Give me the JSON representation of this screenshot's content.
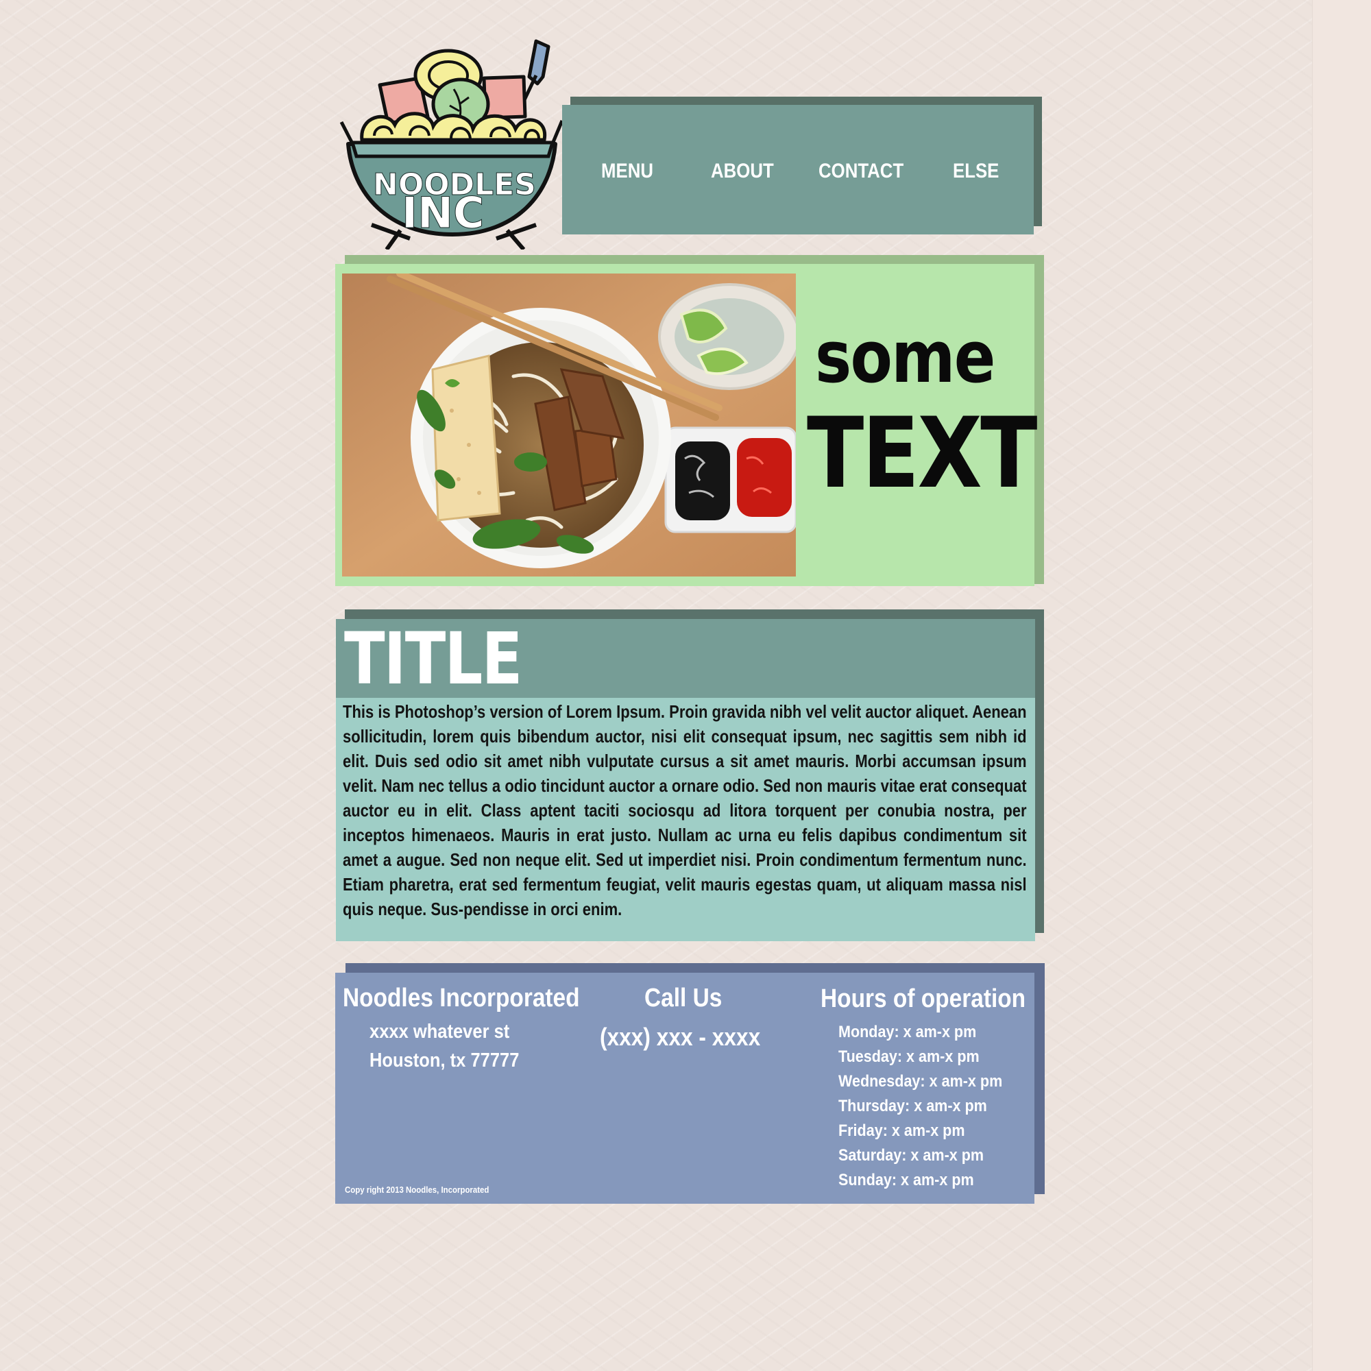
{
  "logo": {
    "line1": "NOODLES",
    "line2": "INC"
  },
  "nav": {
    "items": [
      "MENU",
      "ABOUT",
      "CONTACT",
      "ELSE"
    ]
  },
  "hero": {
    "small_text": "some",
    "big_text": "TEXT"
  },
  "content": {
    "title": "TITLE",
    "body": "This is Photoshop’s version  of Lorem Ipsum. Proin gravida nibh vel velit auctor aliquet. Aenean sollicitudin, lorem quis bibendum auctor, nisi elit consequat ipsum, nec sagittis sem nibh id elit. Duis sed odio sit amet nibh vulputate cursus a sit amet mauris. Morbi accumsan ipsum velit. Nam nec tellus a odio tincidunt auctor a ornare odio. Sed non  mauris vitae erat consequat auctor eu in elit. Class aptent taciti sociosqu ad litora torquent per conubia nostra, per inceptos himenaeos. Mauris in erat justo. Nullam ac urna eu felis dapibus condimentum sit amet a augue. Sed non neque elit. Sed ut imperdiet nisi. Proin condimentum fermentum nunc. Etiam pharetra, erat sed fermentum feugiat, velit mauris egestas quam, ut aliquam massa nisl quis neque. Sus-pendisse in orci enim."
  },
  "footer": {
    "company": "Noodles Incorporated",
    "address_line1": "xxxx whatever st",
    "address_line2": "Houston, tx 77777",
    "call_heading": "Call Us",
    "phone": "(xxx) xxx - xxxx",
    "hours_heading": "Hours of operation",
    "hours": [
      "Monday: x am-x pm",
      "Tuesday: x am-x pm",
      "Wednesday: x am-x pm",
      "Thursday: x am-x pm",
      "Friday: x am-x pm",
      "Saturday: x am-x pm",
      "Sunday: x am-x pm"
    ],
    "copyright": "Copy right 2013 Noodles, Incorporated"
  },
  "colors": {
    "page_bg": "#ede3dd",
    "nav_bg": "#769d96",
    "hero_bg": "#b7e6ab",
    "content_bg": "#9fcec6",
    "footer_bg": "#8598bc"
  }
}
